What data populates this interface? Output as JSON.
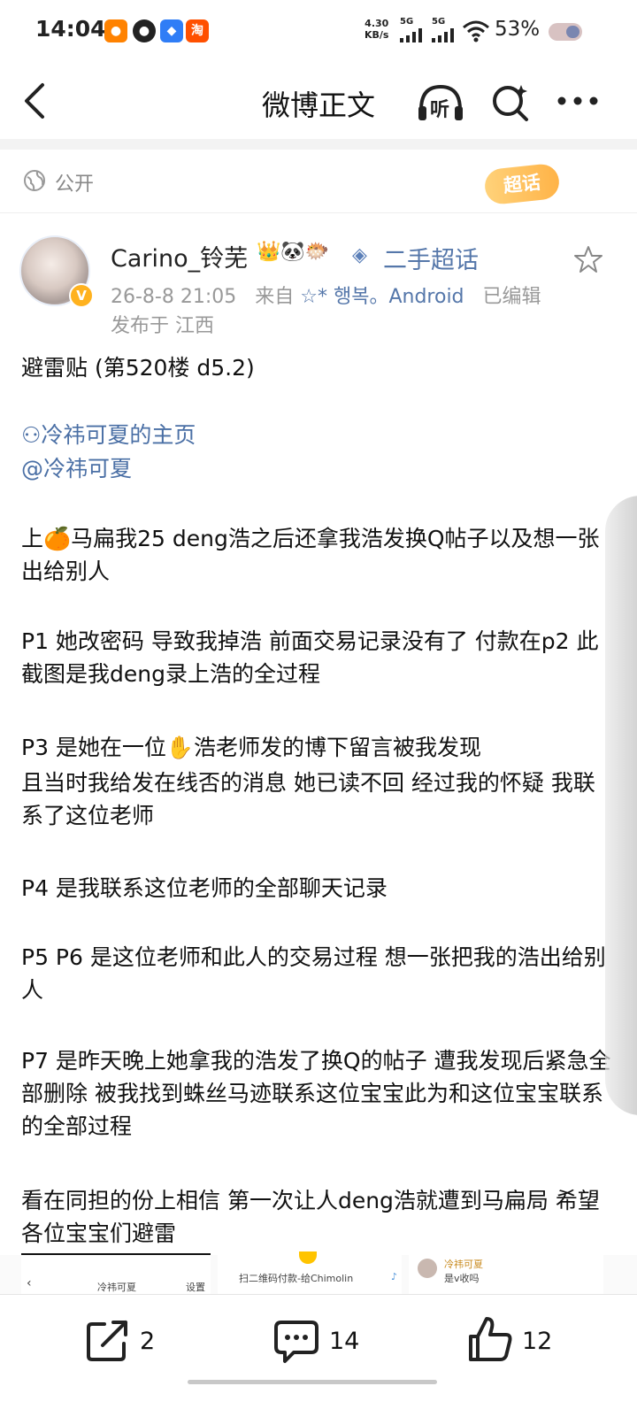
{
  "status_bar": {
    "time": "14:04",
    "apps": [
      "weibo-icon",
      "qq-icon",
      "message-app-icon",
      "taobao-icon"
    ],
    "taobao_label": "淘",
    "net_speed_value": "4.30",
    "net_speed_unit": "KB/s",
    "signal_1": "5G",
    "signal_2": "5G",
    "battery": "53%"
  },
  "nav": {
    "title": "微博正文",
    "listen_label": "听"
  },
  "visibility": {
    "label": "公开",
    "supertopic_tag": "超话"
  },
  "author": {
    "name": "Carino_铃芜",
    "emoji": "👑🐼🐡",
    "supertopic": "二手超话",
    "time": "26-8-8 21:05",
    "from_label": "来自",
    "source": "☆* 행복。Android",
    "edited": "已编辑",
    "location": "发布于 江西"
  },
  "post": {
    "title": "避雷贴 (第520楼 d5.2)",
    "home_link": "冷祎可夏的主页",
    "mention": "@冷祎可夏",
    "para1": "上🍊马扁我25 deng浩之后还拿我浩发换Q帖子以及想一张出给别人",
    "para2": "P1 她改密码 导致我掉浩 前面交易记录没有了 付款在p2 此截图是我deng录上浩的全过程",
    "para3a": "P3 是她在一位✋浩老师发的博下留言被我发现",
    "para3b": " 且当时我给发在线否的消息 她已读不回 经过我的怀疑 我联系了这位老师",
    "para4": "P4 是我联系这位老师的全部聊天记录",
    "para5": "P5 P6 是这位老师和此人的交易过程 想一张把我的浩出给别人",
    "para6": "P7 是昨天晚上她拿我的浩发了换Q的帖子 遭我发现后紧急全部删除 被我找到蛛丝马迹联系这位宝宝此为和这位宝宝联系的全部过程",
    "para7": "看在同担的份上相信 第一次让人deng浩就遭到马扁局 希望各位宝宝们避雷"
  },
  "thumbnails": {
    "t1_name": "冷祎可夏",
    "t1_settings": "设置",
    "t2_text": "扫二维码付款-给Chimolin",
    "t3_name": "冷祎可夏",
    "t3_text": "是v收吗"
  },
  "actions": {
    "share_count": "2",
    "comment_count": "14",
    "like_count": "12"
  },
  "colors": {
    "link": "#4a6fa5",
    "meta": "#999999",
    "supertag": "#ffb347"
  }
}
